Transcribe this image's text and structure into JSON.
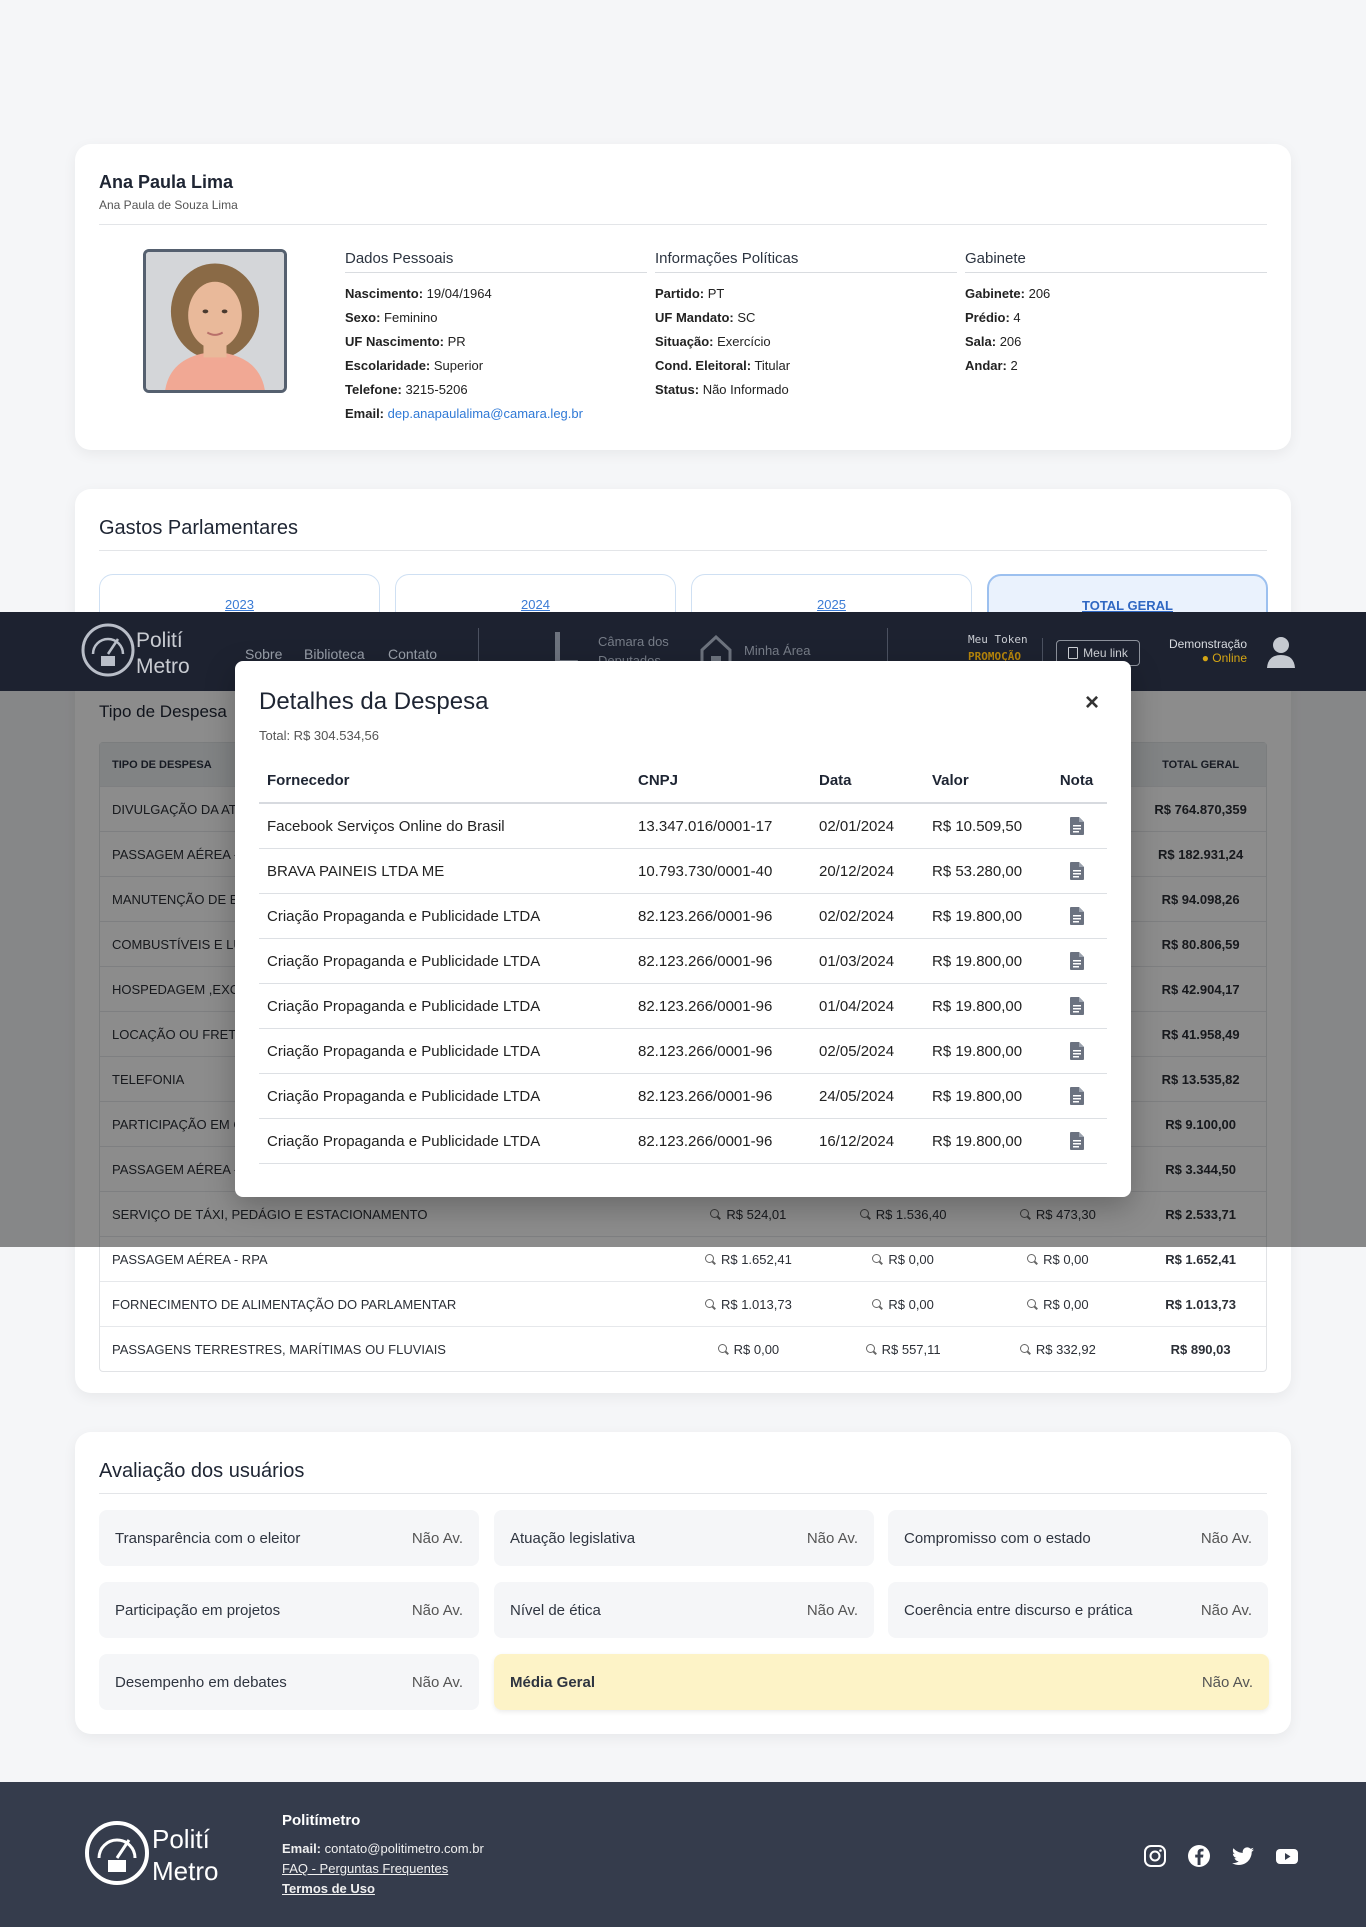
{
  "profile": {
    "name": "Ana Paula Lima",
    "full_name": "Ana Paula de Souza Lima",
    "dados_pessoais": {
      "title": "Dados Pessoais",
      "rows": [
        {
          "label": "Nascimento:",
          "value": "19/04/1964"
        },
        {
          "label": "Sexo:",
          "value": "Feminino"
        },
        {
          "label": "UF Nascimento:",
          "value": "PR"
        },
        {
          "label": "Escolaridade:",
          "value": "Superior"
        },
        {
          "label": "Telefone:",
          "value": "3215-5206"
        },
        {
          "label": "Email:",
          "value": "dep.anapaulalima@camara.leg.br"
        }
      ]
    },
    "info_politicas": {
      "title": "Informações Políticas",
      "rows": [
        {
          "label": "Partido:",
          "value": "PT"
        },
        {
          "label": "UF Mandato:",
          "value": "SC"
        },
        {
          "label": "Situação:",
          "value": "Exercício"
        },
        {
          "label": "Cond. Eleitoral:",
          "value": "Titular"
        },
        {
          "label": "Status:",
          "value": "Não Informado"
        }
      ]
    },
    "gabinete": {
      "title": "Gabinete",
      "rows": [
        {
          "label": "Gabinete:",
          "value": "206"
        },
        {
          "label": "Prédio:",
          "value": "4"
        },
        {
          "label": "Sala:",
          "value": "206"
        },
        {
          "label": "Andar:",
          "value": "2"
        }
      ]
    }
  },
  "gastos": {
    "title": "Gastos Parlamentares",
    "tabs": [
      "2023",
      "2024",
      "2025",
      "TOTAL GERAL"
    ],
    "tipo_title": "Tipo de Despesa",
    "header": {
      "tipo": "TIPO DE DESPESA",
      "total": "TOTAL GERAL"
    },
    "rows_visible_left": [
      "DIVULGAÇÃO DA AT",
      "PASSAGEM AÉREA -",
      "MANUTENÇÃO DE E",
      "COMBUSTÍVEIS E LU",
      "HOSPEDAGEM ,EXC",
      "LOCAÇÃO OU FRETA",
      "TELEFONIA",
      "PARTICIPAÇÃO EM C",
      "PASSAGEM AÉREA -"
    ],
    "totals_visible": [
      "R$ 764.870,359",
      "R$ 182.931,24",
      "R$ 94.098,26",
      "R$ 80.806,59",
      "R$ 42.904,17",
      "R$ 41.958,49",
      "R$ 13.535,82",
      "R$ 9.100,00",
      "R$ 3.344,50"
    ],
    "rows_full": [
      {
        "tipo": "SERVIÇO DE TÁXI, PEDÁGIO E ESTACIONAMENTO",
        "y2023": "R$ 524,01",
        "y2024": "R$ 1.536,40",
        "y2025": "R$ 473,30",
        "total": "R$ 2.533,71"
      },
      {
        "tipo": "PASSAGEM AÉREA - RPA",
        "y2023": "R$ 1.652,41",
        "y2024": "R$ 0,00",
        "y2025": "R$ 0,00",
        "total": "R$ 1.652,41"
      },
      {
        "tipo": "FORNECIMENTO DE ALIMENTAÇÃO DO PARLAMENTAR",
        "y2023": "R$ 1.013,73",
        "y2024": "R$ 0,00",
        "y2025": "R$ 0,00",
        "total": "R$ 1.013,73"
      },
      {
        "tipo": "PASSAGENS TERRESTRES, MARÍTIMAS OU FLUVIAIS",
        "y2023": "R$ 0,00",
        "y2024": "R$ 557,11",
        "y2025": "R$ 332,92",
        "total": "R$ 890,03"
      }
    ]
  },
  "avaliacao": {
    "title": "Avaliação dos usuários",
    "items": [
      {
        "label": "Transparência com o eleitor",
        "value": "Não Av."
      },
      {
        "label": "Atuação legislativa",
        "value": "Não Av."
      },
      {
        "label": "Compromisso com o estado",
        "value": "Não Av."
      },
      {
        "label": "Participação em projetos",
        "value": "Não Av."
      },
      {
        "label": "Nível de ética",
        "value": "Não Av."
      },
      {
        "label": "Coerência entre discurso e prática",
        "value": "Não Av."
      },
      {
        "label": "Desempenho em debates",
        "value": "Não Av."
      }
    ],
    "media": {
      "label": "Média Geral",
      "value": "Não Av."
    }
  },
  "navbar": {
    "logo_top": "Polití",
    "logo_bottom": "Metro",
    "links": [
      "Sobre",
      "Biblioteca",
      "Contato"
    ],
    "camara_line1": "Câmara dos",
    "camara_line2": "Deputados",
    "minha_area": "Minha Área",
    "token_label": "Meu Token",
    "token_value": "PROMOÇÃO",
    "meu_link": "Meu link",
    "user": "Demonstração",
    "status": "● Online"
  },
  "modal": {
    "title": "Detalhes da Despesa",
    "close": "×",
    "total": "Total: R$ 304.534,56",
    "headers": [
      "Fornecedor",
      "CNPJ",
      "Data",
      "Valor",
      "Nota"
    ],
    "rows": [
      {
        "fornecedor": "Facebook Serviços Online do Brasil",
        "cnpj": "13.347.016/0001-17",
        "data": "02/01/2024",
        "valor": "R$ 10.509,50"
      },
      {
        "fornecedor": "BRAVA PAINEIS LTDA ME",
        "cnpj": "10.793.730/0001-40",
        "data": "20/12/2024",
        "valor": "R$ 53.280,00"
      },
      {
        "fornecedor": "Criação Propaganda e Publicidade LTDA",
        "cnpj": "82.123.266/0001-96",
        "data": "02/02/2024",
        "valor": "R$ 19.800,00"
      },
      {
        "fornecedor": "Criação Propaganda e Publicidade LTDA",
        "cnpj": "82.123.266/0001-96",
        "data": "01/03/2024",
        "valor": "R$ 19.800,00"
      },
      {
        "fornecedor": "Criação Propaganda e Publicidade LTDA",
        "cnpj": "82.123.266/0001-96",
        "data": "01/04/2024",
        "valor": "R$ 19.800,00"
      },
      {
        "fornecedor": "Criação Propaganda e Publicidade LTDA",
        "cnpj": "82.123.266/0001-96",
        "data": "02/05/2024",
        "valor": "R$ 19.800,00"
      },
      {
        "fornecedor": "Criação Propaganda e Publicidade LTDA",
        "cnpj": "82.123.266/0001-96",
        "data": "24/05/2024",
        "valor": "R$ 19.800,00"
      },
      {
        "fornecedor": "Criação Propaganda e Publicidade LTDA",
        "cnpj": "82.123.266/0001-96",
        "data": "16/12/2024",
        "valor": "R$ 19.800,00"
      }
    ]
  },
  "footer": {
    "brand": "Politímetro",
    "email_label": "Email:",
    "email": "contato@politimetro.com.br",
    "faq": "FAQ - Perguntas Frequentes",
    "termos": "Termos de Uso",
    "social": [
      "instagram-icon",
      "facebook-icon",
      "twitter-icon",
      "youtube-icon"
    ]
  }
}
